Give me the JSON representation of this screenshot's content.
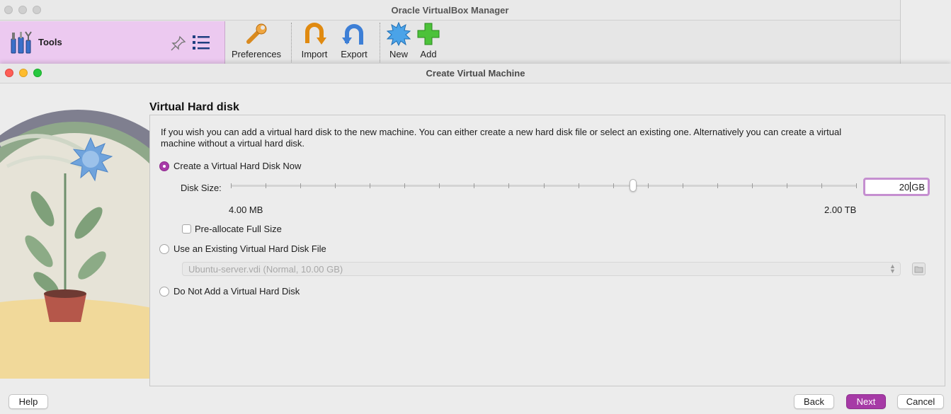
{
  "manager": {
    "title": "Oracle VirtualBox Manager",
    "tools_label": "Tools",
    "toolbar": [
      {
        "label": "Preferences",
        "icon": "wrench-icon"
      },
      {
        "label": "Import",
        "icon": "import-arrow-icon"
      },
      {
        "label": "Export",
        "icon": "export-arrow-icon"
      },
      {
        "label": "New",
        "icon": "new-star-icon"
      },
      {
        "label": "Add",
        "icon": "add-plus-icon"
      }
    ]
  },
  "dialog": {
    "title": "Create Virtual Machine",
    "section_title": "Virtual Hard disk",
    "description": "If you wish you can add a virtual hard disk to the new machine. You can either create a new hard disk file or select an existing one. Alternatively you can create a virtual machine without a virtual hard disk.",
    "options": {
      "create_now": "Create a Virtual Hard Disk Now",
      "use_existing": "Use an Existing Virtual Hard Disk File",
      "do_not_add": "Do Not Add a Virtual Hard Disk"
    },
    "selected_option": "create_now",
    "disk_size": {
      "label": "Disk Size:",
      "min_label": "4.00 MB",
      "max_label": "2.00 TB",
      "value": "20",
      "unit": "GB",
      "slider_fraction": 0.643
    },
    "preallocate_label": "Pre-allocate Full Size",
    "preallocate_checked": false,
    "existing_disk_value": "Ubuntu-server.vdi (Normal, 10.00 GB)",
    "buttons": {
      "help": "Help",
      "back": "Back",
      "next": "Next",
      "cancel": "Cancel"
    }
  },
  "colors": {
    "accent": "#a63aa6",
    "tools_bg": "#ecc9f0"
  }
}
